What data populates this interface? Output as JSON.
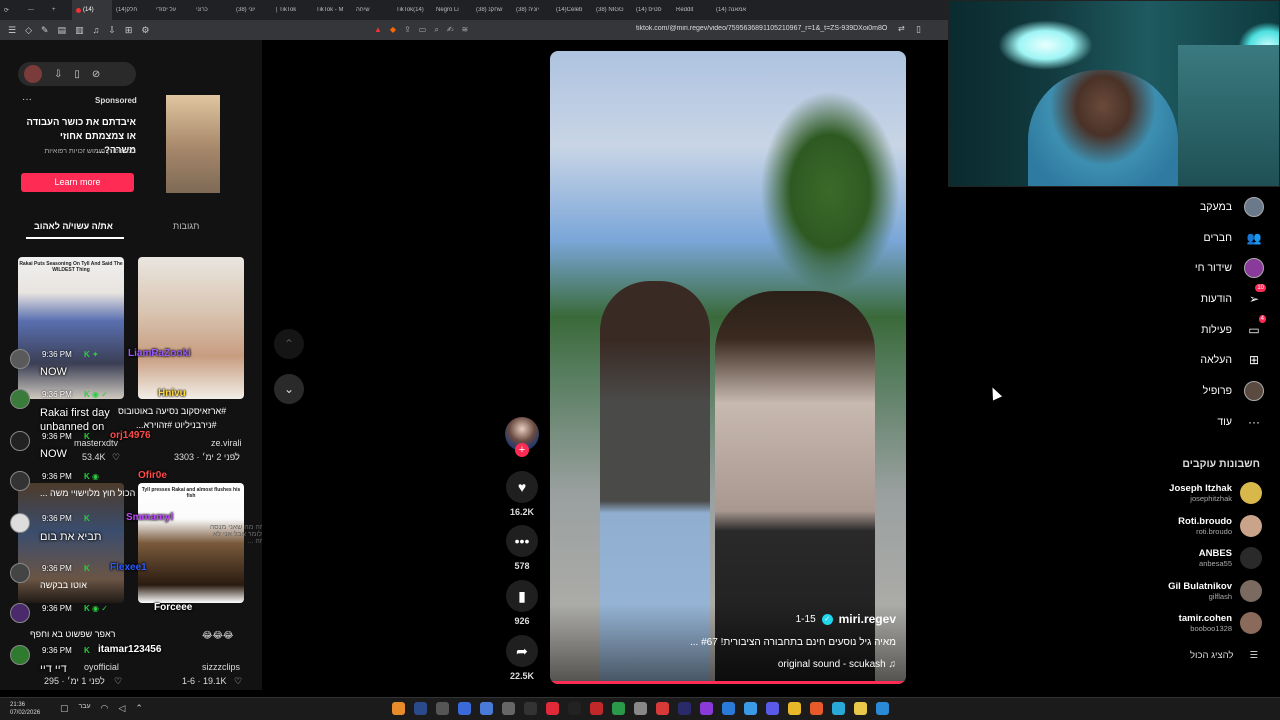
{
  "browser": {
    "tabs": [
      "(14)",
      "(14)חלק",
      "על יסודי",
      "כרוני",
      "(38) יוני",
      "| TikTok",
      "TikTok - M",
      "שיחה",
      "TikTok(14)",
      "Negro Li",
      "(38) שחקנ",
      "(38) יוניה",
      "(14)Celeb",
      "(38) NIGG",
      "סטיס (14)",
      "Reddit",
      "(14) אמאנה"
    ],
    "url": "tiktok.com/@miri.regev/video/7595636891105210967_r=1&_t=ZS-939DXoi0m8O"
  },
  "left_panel": {
    "sponsored_label": "Sponsored",
    "ad_headline": "איבדתם את כושר העבודה או צמצמתם אחוזי משרה?...",
    "ad_sub": "לבנת פורן מימוש זכויות רפואיות",
    "learn_more": "Learn more",
    "tab_liked": "את/ה עשוי/ה לאהוב",
    "tab_comments": "תגובות",
    "thumb1_caption": "Rakai Puts Seasoning On Tyll And Said The WILDEST Thing",
    "thumb4_caption": "Tyll presses Rakai and almost flushes his fish",
    "video1_caption": "#ארזאיסקוב נסיעה באוטובוס",
    "video2_caption": "#נירבניליוט #זהוירא...",
    "video1_author": "masterxdtv",
    "video1_stats": "53.4K",
    "video2_author": "ze.virali",
    "video2_stats": "לפני 2 ימ׳ · 3303",
    "video3_caption": "הכול חוץ מלוישויי משה ...",
    "video4_caption": "ראפר שפשוט בא וחפף",
    "video3_author": "oyofficial",
    "video3_stats": "לפני 1 ימ׳ · 295",
    "video4_author": "sizzzclips",
    "video4_stats": "1-6 · 19.1K",
    "video4_emoji": "😂😂😂",
    "faint_overlay": "זה מה שאני מנסה לומר אבל אני לא זה ...",
    "video5_caption": "אוטו בבקשה"
  },
  "chat": {
    "messages": [
      {
        "time": "9:36 PM",
        "user": "LiamRaZooki",
        "color": "#9b59ff",
        "text": "NOW"
      },
      {
        "time": "9:36 PM",
        "user": "Hnivu",
        "color": "#ffd93b",
        "text": "Rakai first day unbanned on"
      },
      {
        "time": "9:36 PM",
        "user": "orj14976",
        "color": "#ff4a4a",
        "text": "NOW"
      },
      {
        "time": "9:36 PM",
        "user": "Ofir0e",
        "color": "#ff4a4a",
        "text": ""
      },
      {
        "time": "9:36 PM",
        "user": "Smmamyl",
        "color": "#c04aff",
        "text": "תביא את בום"
      },
      {
        "time": "9:36 PM",
        "user": "Flexee1",
        "color": "#2a5cff",
        "text": ""
      },
      {
        "time": "9:36 PM",
        "user": "Forceee",
        "color": "#ffffff",
        "text": ""
      },
      {
        "time": "9:36 PM",
        "user": "itamar123456",
        "color": "#ffffff",
        "text": "דיי דיי"
      }
    ]
  },
  "video": {
    "author": "miri.regev",
    "date": "1-15",
    "description": "מאיה גיל נוסעים חינם בתחבורה הציבורית! #67 ...",
    "sound": "original sound - scukash",
    "likes": "16.2K",
    "comments": "578",
    "saves": "926",
    "shares": "22.5K"
  },
  "nav": {
    "items": [
      {
        "label": "במעקב",
        "icon": "avatar-icon",
        "badge": ""
      },
      {
        "label": "חברים",
        "icon": "friends-icon",
        "badge": ""
      },
      {
        "label": "שידור חי",
        "icon": "live-icon",
        "badge": ""
      },
      {
        "label": "הודעות",
        "icon": "messages-icon",
        "badge": "10"
      },
      {
        "label": "פעילות",
        "icon": "activity-icon",
        "badge": "4"
      },
      {
        "label": "העלאה",
        "icon": "upload-icon",
        "badge": ""
      },
      {
        "label": "פרופיל",
        "icon": "profile-icon",
        "badge": ""
      },
      {
        "label": "עוד",
        "icon": "more-icon",
        "badge": ""
      }
    ],
    "following_header": "חשבונות עוקבים",
    "accounts": [
      {
        "name": "Joseph Itzhak",
        "handle": "josephitzhak",
        "color": "#d8b84a"
      },
      {
        "name": "Roti.broudo",
        "handle": "roti.broudo",
        "color": "#c9a48a"
      },
      {
        "name": "ANBES",
        "handle": "anbesa55",
        "color": "#2a2a2a"
      },
      {
        "name": "Gil Bulatnikov",
        "handle": "gilflash",
        "color": "#7a6a60"
      },
      {
        "name": "tamir.cohen",
        "handle": "booboo1328",
        "color": "#8a6a5a"
      }
    ],
    "show_all": "להציג הכול"
  },
  "taskbar": {
    "time": "21:36",
    "date": "07/02/2026",
    "lang": "עבר"
  },
  "colors": {
    "accent": "#fe2c55",
    "bg": "#000000"
  }
}
